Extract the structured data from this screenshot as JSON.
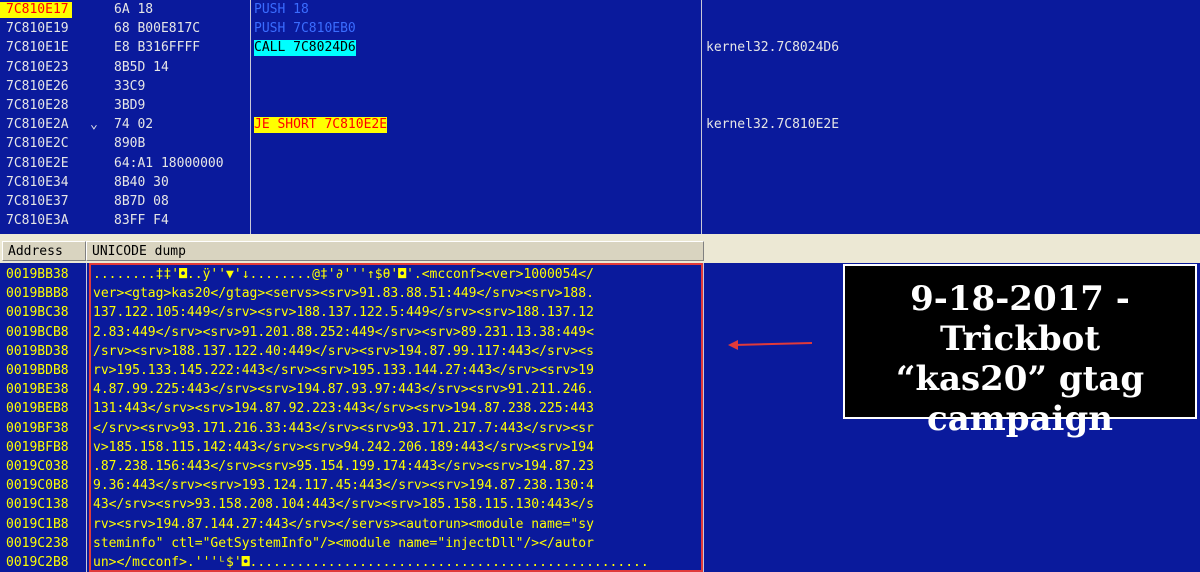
{
  "disasm": {
    "rows": [
      {
        "addr": "7C810E17",
        "jmp": "",
        "hex": "6A 18",
        "ins": "PUSH 18",
        "ins_style": "blue",
        "comment": "",
        "selected": true
      },
      {
        "addr": "7C810E19",
        "jmp": "",
        "hex": "68 B00E817C",
        "ins": "PUSH 7C810EB0",
        "ins_style": "blue",
        "comment": "",
        "selected": false
      },
      {
        "addr": "7C810E1E",
        "jmp": "",
        "hex": "E8 B316FFFF",
        "ins": "CALL 7C8024D6",
        "ins_style": "call",
        "comment": "kernel32.7C8024D6",
        "selected": false
      },
      {
        "addr": "7C810E23",
        "jmp": "",
        "hex": "8B5D 14",
        "ins": "",
        "ins_style": "plain",
        "comment": "",
        "selected": false
      },
      {
        "addr": "7C810E26",
        "jmp": "",
        "hex": "33C9",
        "ins": "",
        "ins_style": "plain",
        "comment": "",
        "selected": false
      },
      {
        "addr": "7C810E28",
        "jmp": "",
        "hex": "3BD9",
        "ins": "",
        "ins_style": "plain",
        "comment": "",
        "selected": false
      },
      {
        "addr": "7C810E2A",
        "jmp": "⌄",
        "hex": "74 02",
        "ins": "JE SHORT 7C810E2E",
        "ins_style": "jump",
        "comment": "kernel32.7C810E2E",
        "selected": false
      },
      {
        "addr": "7C810E2C",
        "jmp": "",
        "hex": "890B",
        "ins": "",
        "ins_style": "plain",
        "comment": "",
        "selected": false
      },
      {
        "addr": "7C810E2E",
        "jmp": "",
        "hex": "64:A1 18000000",
        "ins": "",
        "ins_style": "plain",
        "comment": "",
        "selected": false
      },
      {
        "addr": "7C810E34",
        "jmp": "",
        "hex": "8B40 30",
        "ins": "",
        "ins_style": "plain",
        "comment": "",
        "selected": false
      },
      {
        "addr": "7C810E37",
        "jmp": "",
        "hex": "8B7D 08",
        "ins": "",
        "ins_style": "plain",
        "comment": "",
        "selected": false
      },
      {
        "addr": "7C810E3A",
        "jmp": "",
        "hex": "83FF F4",
        "ins": "",
        "ins_style": "plain",
        "comment": "",
        "selected": false
      }
    ]
  },
  "dump": {
    "header_address": "Address",
    "header_dump": "UNICODE dump",
    "rows": [
      {
        "addr": "0019BB38",
        "text": "........‡‡'◘..ÿ''▼'↓........@‡'∂'''↑$θ'◘'.<mcconf><ver>1000054</"
      },
      {
        "addr": "0019BBB8",
        "text": "ver><gtag>kas20</gtag><servs><srv>91.83.88.51:449</srv><srv>188."
      },
      {
        "addr": "0019BC38",
        "text": "137.122.105:449</srv><srv>188.137.122.5:449</srv><srv>188.137.12"
      },
      {
        "addr": "0019BCB8",
        "text": "2.83:449</srv><srv>91.201.88.252:449</srv><srv>89.231.13.38:449<"
      },
      {
        "addr": "0019BD38",
        "text": "/srv><srv>188.137.122.40:449</srv><srv>194.87.99.117:443</srv><s"
      },
      {
        "addr": "0019BDB8",
        "text": "rv>195.133.145.222:443</srv><srv>195.133.144.27:443</srv><srv>19"
      },
      {
        "addr": "0019BE38",
        "text": "4.87.99.225:443</srv><srv>194.87.93.97:443</srv><srv>91.211.246."
      },
      {
        "addr": "0019BEB8",
        "text": "131:443</srv><srv>194.87.92.223:443</srv><srv>194.87.238.225:443"
      },
      {
        "addr": "0019BF38",
        "text": "</srv><srv>93.171.216.33:443</srv><srv>93.171.217.7:443</srv><sr"
      },
      {
        "addr": "0019BFB8",
        "text": "v>185.158.115.142:443</srv><srv>94.242.206.189:443</srv><srv>194"
      },
      {
        "addr": "0019C038",
        "text": ".87.238.156:443</srv><srv>95.154.199.174:443</srv><srv>194.87.23"
      },
      {
        "addr": "0019C0B8",
        "text": "9.36:443</srv><srv>193.124.117.45:443</srv><srv>194.87.238.130:4"
      },
      {
        "addr": "0019C138",
        "text": "43</srv><srv>93.158.208.104:443</srv><srv>185.158.115.130:443</s"
      },
      {
        "addr": "0019C1B8",
        "text": "rv><srv>194.87.144.27:443</srv></servs><autorun><module name=\"sy"
      },
      {
        "addr": "0019C238",
        "text": "steminfo\" ctl=\"GetSystemInfo\"/><module name=\"injectDll\"/></autor"
      },
      {
        "addr": "0019C2B8",
        "text": "un></mcconf>.'''ᴸ$'◘..................................................."
      }
    ]
  },
  "annotation": {
    "line1": "9-18-2017 - Trickbot",
    "line2": "“kas20” gtag",
    "line3": "campaign"
  },
  "colors": {
    "background": "#0a1a9c",
    "dump_text": "#ffff00",
    "highlight": "#e03a3a",
    "call_bg": "#00ffff",
    "jump_bg": "#ffff00"
  }
}
